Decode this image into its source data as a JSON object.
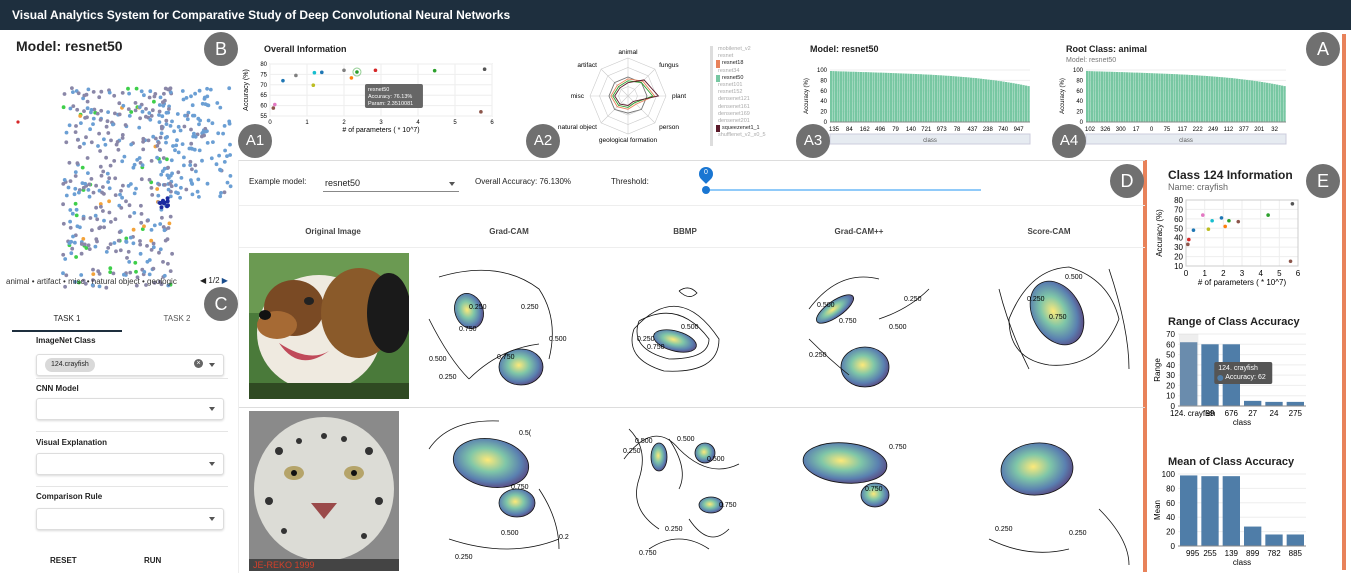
{
  "app": {
    "title": "Visual Analytics System for Comparative Study of Deep Convolutional Neural Networks"
  },
  "labels": {
    "A": "A",
    "A1": "A1",
    "A2": "A2",
    "A3": "A3",
    "A4": "A4",
    "B": "B",
    "C": "C",
    "D": "D",
    "E": "E"
  },
  "left": {
    "model_title": "Model: resnet50",
    "legend": "animal • artifact • misc • natural object • geologic",
    "pager": "1/2",
    "tabs": [
      "TASK 1",
      "TASK 2"
    ],
    "fields": [
      {
        "label": "ImageNet Class",
        "value": "124.crayfish"
      },
      {
        "label": "CNN Model",
        "value": ""
      },
      {
        "label": "Visual Explanation",
        "value": ""
      },
      {
        "label": "Comparison Rule",
        "value": ""
      }
    ],
    "reset": "RESET",
    "run": "RUN"
  },
  "overall": {
    "title": "Overall Information",
    "ylabel": "Accuracy (%)",
    "xlabel": "# of parameters ( * 10^7)",
    "yticks": [
      "80",
      "75",
      "70",
      "65",
      "60",
      "55"
    ],
    "xticks": [
      "0",
      "1",
      "2",
      "3",
      "4",
      "5",
      "6"
    ],
    "tooltip": [
      "resnet50",
      "Accuracy: 76.13%",
      "Param: 2.3510081"
    ]
  },
  "radar": {
    "axes": [
      "animal",
      "fungus",
      "plant",
      "person",
      "geological formation",
      "natural object",
      "misc",
      "artifact"
    ]
  },
  "model_list": [
    "mobilenet_v2",
    "resnet",
    "resnet18",
    "resnet34",
    "resnet50",
    "resnet101",
    "resnet152",
    "densenet121",
    "densenet161",
    "densenet169",
    "densenet201",
    "squeezenet1_1",
    "shufflenet_v2_x0_5"
  ],
  "a3": {
    "title": "Model: resnet50",
    "ylabel": "Accuracy (%)",
    "yticks": [
      "100",
      "80",
      "60",
      "40",
      "20",
      "0"
    ],
    "xticks": [
      "135",
      "84",
      "162",
      "496",
      "79",
      "140",
      "721",
      "973",
      "78",
      "437",
      "238",
      "740",
      "947"
    ],
    "xlabel": "class"
  },
  "a4": {
    "title": "Root Class: animal",
    "subtitle": "Model: resnet50",
    "ylabel": "Accuracy (%)",
    "yticks": [
      "100",
      "80",
      "60",
      "40",
      "20",
      "0"
    ],
    "xticks": [
      "102",
      "326",
      "300",
      "17",
      "0",
      "75",
      "117",
      "222",
      "249",
      "112",
      "377",
      "201",
      "32"
    ],
    "xlabel": "class"
  },
  "main": {
    "example_label": "Example model:",
    "example_value": "resnet50",
    "overall_acc": "Overall Accuracy: 76.130%",
    "threshold_label": "Threshold:",
    "threshold_value": "0",
    "columns": [
      "Original Image",
      "Grad-CAM",
      "BBMP",
      "Grad-CAM++",
      "Score-CAM"
    ],
    "contour_labels": {
      "r1gc": [
        "0.250",
        "0.250",
        "0.500",
        "0.750",
        "0.500",
        "0.250",
        "0.750"
      ],
      "r1bb": [
        "0.250",
        "0.500",
        "0.750"
      ],
      "r1gp": [
        "0.500",
        "0.250",
        "0.750",
        "0.250",
        "0.500"
      ],
      "r1sc": [
        "0.250",
        "0.500",
        "0.750"
      ],
      "r2gc": [
        "0.5(",
        "0.750",
        "0.500",
        "0.250",
        "0.2"
      ],
      "r2bb": [
        "0.250",
        "0.500",
        "0.500",
        "0.750",
        "0.250",
        "0.500",
        "0.750"
      ],
      "r2gp": [
        "0.750",
        "0.750"
      ],
      "r2sc": [
        "0.250",
        "0.250"
      ]
    },
    "img2_caption": "JE-REKO 1999"
  },
  "right": {
    "title": "Class 124 Information",
    "subtitle": "Name: crayfish",
    "scatter": {
      "ylabel": "Accuracy (%)",
      "xlabel": "# of parameters ( * 10^7)",
      "yticks": [
        "80",
        "70",
        "60",
        "50",
        "40",
        "30",
        "20",
        "10"
      ],
      "xticks": [
        "0",
        "1",
        "2",
        "3",
        "4",
        "5",
        "6"
      ]
    },
    "range": {
      "title": "Range of Class Accuracy",
      "ylabel": "Range",
      "yticks": [
        "70",
        "60",
        "50",
        "40",
        "30",
        "20",
        "10",
        "0"
      ],
      "xticks": [
        "124. crayfish",
        "99",
        "676",
        "27",
        "24",
        "275"
      ],
      "xlabel": "class",
      "tooltip": [
        "124. crayfish",
        "Accuracy: 62"
      ]
    },
    "mean": {
      "title": "Mean of Class Accuracy",
      "ylabel": "Mean",
      "yticks": [
        "100",
        "80",
        "60",
        "40",
        "20",
        "0"
      ],
      "xticks": [
        "995",
        "255",
        "139",
        "899",
        "782",
        "885"
      ],
      "xlabel": "class"
    }
  },
  "chart_data": [
    {
      "type": "scatter",
      "title": "Overall Information",
      "xlabel": "# of parameters ( * 10^7)",
      "ylabel": "Accuracy (%)",
      "xlim": [
        0,
        6
      ],
      "ylim": [
        55,
        80
      ],
      "points": [
        {
          "x": 0.09,
          "y": 58.8,
          "color": "#8c564b"
        },
        {
          "x": 0.13,
          "y": 60.5,
          "color": "#e377c2"
        },
        {
          "x": 0.35,
          "y": 72,
          "color": "#1f77b4"
        },
        {
          "x": 0.7,
          "y": 74.5,
          "color": "#7f7f7f"
        },
        {
          "x": 1.17,
          "y": 69.8,
          "color": "#bcbd22"
        },
        {
          "x": 1.2,
          "y": 75.8,
          "color": "#17becf"
        },
        {
          "x": 1.4,
          "y": 76,
          "color": "#1f77b4"
        },
        {
          "x": 2.2,
          "y": 73.3,
          "color": "#ff7f0e"
        },
        {
          "x": 2.0,
          "y": 77,
          "color": "#7f7f7f"
        },
        {
          "x": 2.35,
          "y": 76.13,
          "color": "#2ca02c"
        },
        {
          "x": 2.85,
          "y": 77,
          "color": "#d62728"
        },
        {
          "x": 4.45,
          "y": 76.8,
          "color": "#2ca02c"
        },
        {
          "x": 5.7,
          "y": 57,
          "color": "#8c564b"
        },
        {
          "x": 5.8,
          "y": 77.5,
          "color": "#555555"
        }
      ]
    },
    {
      "type": "bar",
      "title": "Range of Class Accuracy",
      "categories": [
        "124. crayfish",
        "99",
        "676",
        "27",
        "24",
        "275"
      ],
      "values": [
        62,
        60,
        60,
        5,
        4,
        4
      ],
      "xlabel": "class",
      "ylabel": "Range",
      "ylim": [
        0,
        70
      ]
    },
    {
      "type": "bar",
      "title": "Mean of Class Accuracy",
      "categories": [
        "995",
        "255",
        "139",
        "899",
        "782",
        "885"
      ],
      "values": [
        98,
        97,
        97,
        27,
        16,
        16
      ],
      "xlabel": "class",
      "ylabel": "Mean",
      "ylim": [
        0,
        100
      ]
    }
  ],
  "colors": {
    "titlebar": "#1e2f3e",
    "green": "#77c7a2",
    "blue": "#4f7da8",
    "accent": "#1976d2",
    "orange": "#e8825a"
  }
}
